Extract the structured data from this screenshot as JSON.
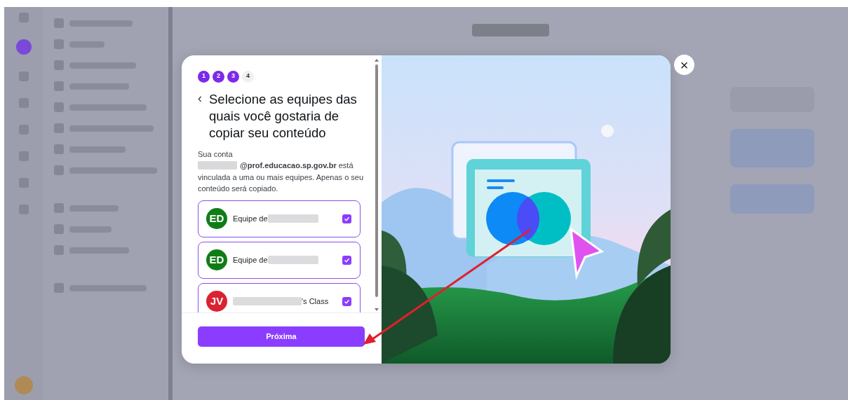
{
  "steps": [
    {
      "label": "1",
      "done": true
    },
    {
      "label": "2",
      "done": true
    },
    {
      "label": "3",
      "done": true
    },
    {
      "label": "4",
      "done": false
    }
  ],
  "back": "‹",
  "title": "Selecione as equipes das quais você gostaria de copiar seu conteúdo",
  "intro": "Sua conta",
  "email_line": "**@prof.educacao.sp.gov.br** está",
  "description": "vinculada a uma ou mais equipes. Apenas o seu conteúdo será copiado.",
  "teams": [
    {
      "initials": "ED",
      "color": "#0f7d16",
      "label": "Equipe de",
      "kind": "prefix",
      "checked": true
    },
    {
      "initials": "ED",
      "color": "#0f7d16",
      "label": "Equipe de",
      "kind": "prefix",
      "checked": true
    },
    {
      "initials": "JV",
      "color": "#d92332",
      "label": "'s Class",
      "kind": "suffix",
      "checked": true
    }
  ],
  "next_button": "Próxima",
  "close": "×"
}
